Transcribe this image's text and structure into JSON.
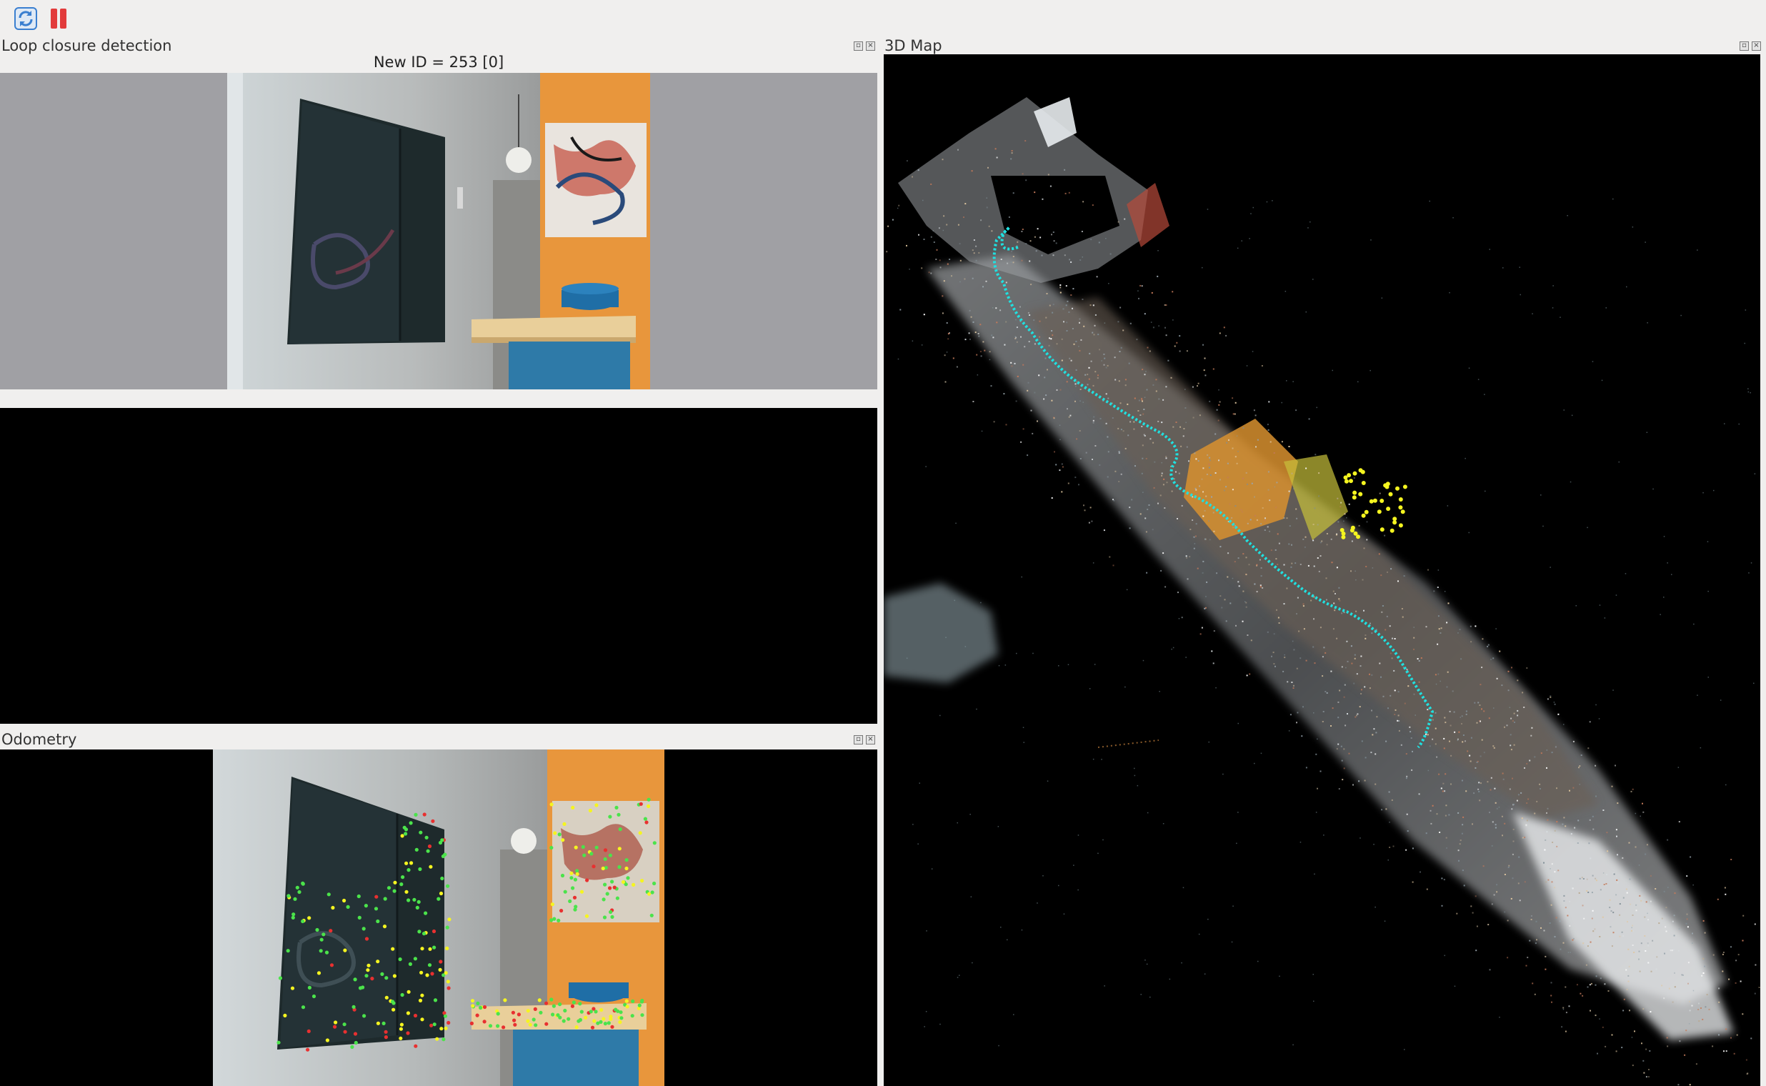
{
  "toolbar": {
    "refresh_icon": "refresh-icon",
    "pause_icon": "pause-icon",
    "colors": {
      "refresh": "#3a7fd0",
      "pause": "#e23b3b"
    }
  },
  "loop_closure": {
    "title": "Loop closure detection",
    "new_id_label": "New ID = 253 [0]"
  },
  "odometry": {
    "title": "Odometry"
  },
  "map3d": {
    "title": "3D Map"
  },
  "dock_buttons": {
    "float": "▫",
    "close": "×"
  },
  "colors": {
    "trajectory": "#20e0e0",
    "features_green": "#4be34b",
    "features_red": "#e83030",
    "features_yellow": "#f5f520",
    "wall_orange": "#e8963c",
    "loop_bg_gray": "#a0a0a4"
  }
}
